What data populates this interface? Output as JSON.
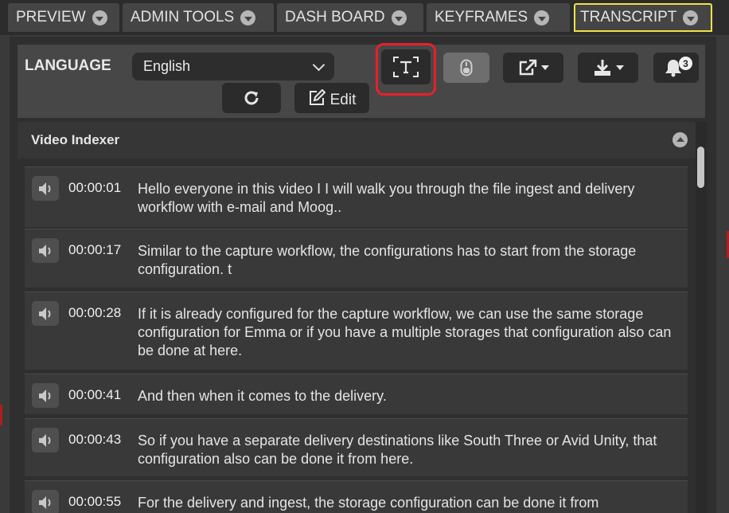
{
  "tabs": [
    {
      "label": "PREVIEW"
    },
    {
      "label": "ADMIN TOOLS"
    },
    {
      "label": "DASH BOARD"
    },
    {
      "label": "KEYFRAMES"
    },
    {
      "label": "TRANSCRIPT"
    }
  ],
  "active_tab": "TRANSCRIPT",
  "toolbar": {
    "language_label": "LANGUAGE",
    "language_value": "English",
    "edit_label": "Edit",
    "notification_count": "3"
  },
  "section": {
    "title": "Video Indexer"
  },
  "transcript": [
    {
      "time": "00:00:01",
      "text": "Hello everyone in this video I I will walk you through the file ingest and delivery workflow with e-mail and Moog.."
    },
    {
      "time": "00:00:17",
      "text": "Similar to the capture workflow, the configurations has to start from the storage configuration. t"
    },
    {
      "time": "00:00:28",
      "text": "If it is already configured for the capture workflow, we can use the same storage configuration for Emma or if you have a multiple storages that configuration also can be done at here."
    },
    {
      "time": "00:00:41",
      "text": "And then when it comes to the delivery."
    },
    {
      "time": "00:00:43",
      "text": "So if you have a separate delivery destinations like South Three or Avid Unity, that configuration also can be done it from here."
    },
    {
      "time": "00:00:55",
      "text": "For the delivery and ingest, the storage configuration can be done it from"
    }
  ],
  "colors": {
    "active_tab_outline": "#ede24a",
    "annotation_highlight": "#e8202a"
  },
  "icons": [
    "chevron-down-icon",
    "transcript-text-icon",
    "mouse-icon",
    "share-external-icon",
    "download-icon",
    "bell-icon",
    "refresh-icon",
    "edit-pencil-icon",
    "speaker-icon",
    "collapse-up-icon"
  ]
}
